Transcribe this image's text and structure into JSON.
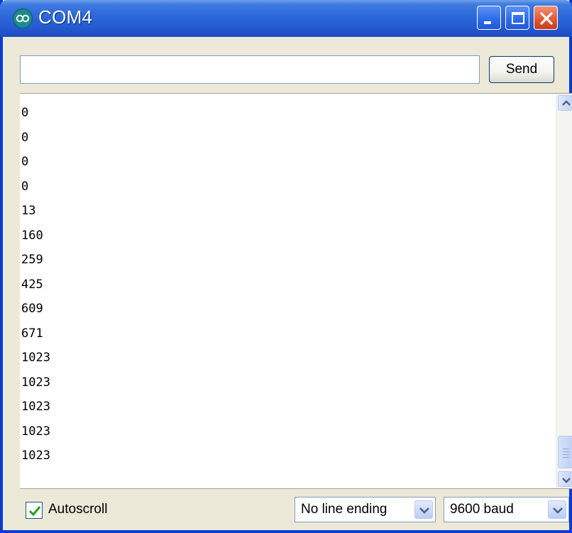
{
  "window": {
    "title": "COM4",
    "title_icon": "arduino-logo-icon",
    "controls": [
      "minimize-icon",
      "maximize-icon",
      "close-icon"
    ]
  },
  "send": {
    "input_value": "",
    "input_placeholder": "",
    "button_label": "Send"
  },
  "output": {
    "lines": [
      "0",
      "0",
      "0",
      "0",
      "13",
      "160",
      "259",
      "425",
      "609",
      "671",
      "1023",
      "1023",
      "1023",
      "1023",
      "1023"
    ]
  },
  "footer": {
    "autoscroll_label": "Autoscroll",
    "autoscroll_checked": true,
    "line_ending": "No line ending",
    "baud": "9600 baud"
  },
  "colors": {
    "titlebar": "#2459cf",
    "close_button": "#e35a36",
    "window_face": "#ece9d8"
  }
}
